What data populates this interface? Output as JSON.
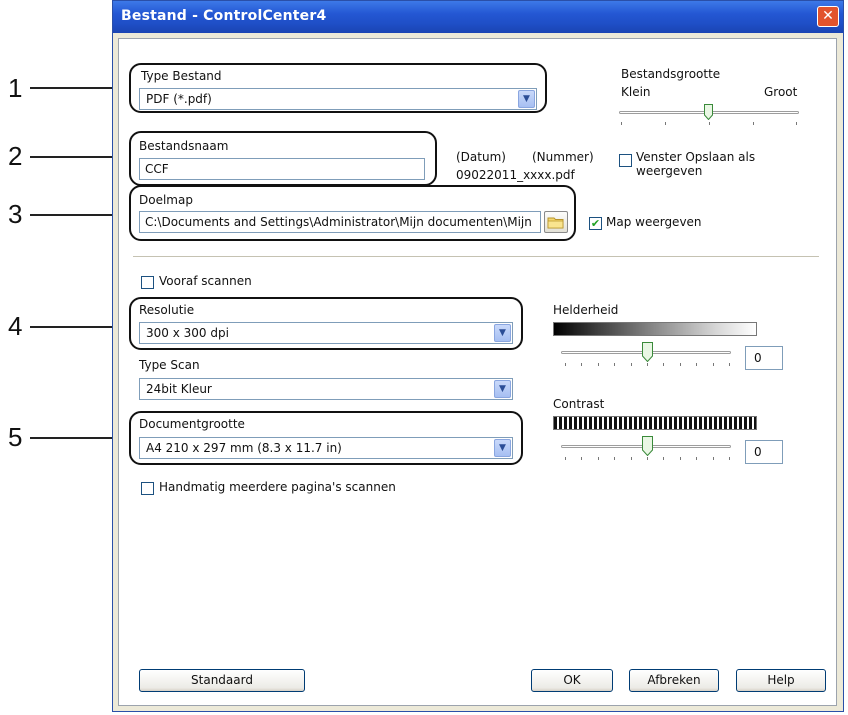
{
  "callouts": [
    "1",
    "2",
    "3",
    "4",
    "5"
  ],
  "window": {
    "title": "Bestand - ControlCenter4",
    "close_glyph": "✕"
  },
  "file_type": {
    "label": "Type Bestand",
    "value": "PDF (*.pdf)"
  },
  "file_size": {
    "label": "Bestandsgrootte",
    "min_label": "Klein",
    "max_label": "Groot",
    "level": 0.5
  },
  "file_name": {
    "label": "Bestandsnaam",
    "value": "CCF",
    "date_header": "(Datum)",
    "number_header": "(Nummer)",
    "example": "09022011_xxxx.pdf"
  },
  "show_save_as": {
    "label": "Venster Opslaan als weergeven",
    "checked": false
  },
  "target_folder": {
    "label": "Doelmap",
    "value": "C:\\Documents and Settings\\Administrator\\Mijn documenten\\Mijn"
  },
  "show_folder": {
    "label": "Map weergeven",
    "checked": true
  },
  "prescan": {
    "label": "Vooraf scannen",
    "checked": false
  },
  "resolution": {
    "label": "Resolutie",
    "value": "300 x 300 dpi"
  },
  "scan_type": {
    "label": "Type Scan",
    "value": "24bit Kleur"
  },
  "document_size": {
    "label": "Documentgrootte",
    "value": "A4 210 x 297 mm (8.3 x 11.7 in)"
  },
  "manual_multipage": {
    "label": "Handmatig meerdere pagina's scannen",
    "checked": false
  },
  "brightness": {
    "label": "Helderheid",
    "value": "0",
    "level": 0.5
  },
  "contrast": {
    "label": "Contrast",
    "value": "0",
    "level": 0.5
  },
  "buttons": {
    "default": "Standaard",
    "ok": "OK",
    "cancel": "Afbreken",
    "help": "Help"
  },
  "colors": {
    "title_bar": "#2457d3",
    "close_button": "#e2532d",
    "dialog_face": "#ece9d8",
    "check_mark": "#21a121"
  }
}
